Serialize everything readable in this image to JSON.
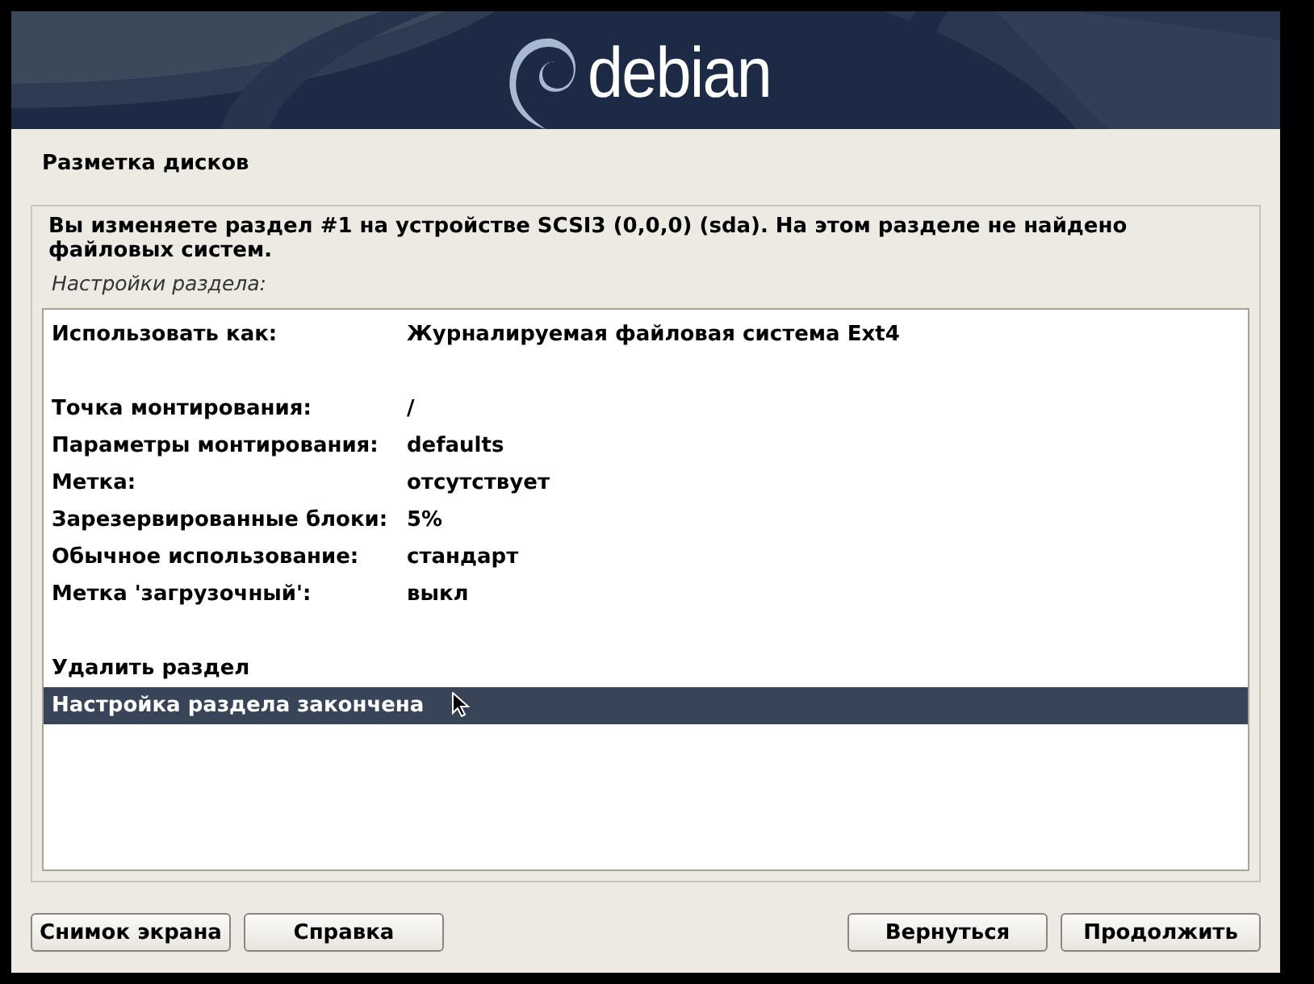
{
  "banner": {
    "logo_text": "debian"
  },
  "title": "Разметка дисков",
  "message": "Вы изменяете раздел #1 на устройстве SCSI3 (0,0,0) (sda). На этом разделе не найдено файловых систем.",
  "list_caption": "Настройки раздела:",
  "groups": [
    [
      {
        "kind": "setting",
        "label": "Использовать как:",
        "value": "Журналируемая файловая система Ext4",
        "selected": false
      }
    ],
    [
      {
        "kind": "setting",
        "label": "Точка монтирования:",
        "value": "/",
        "selected": false
      },
      {
        "kind": "setting",
        "label": "Параметры монтирования:",
        "value": "defaults",
        "selected": false
      },
      {
        "kind": "setting",
        "label": "Метка:",
        "value": "отсутствует",
        "selected": false
      },
      {
        "kind": "setting",
        "label": "Зарезервированные блоки:",
        "value": "5%",
        "selected": false
      },
      {
        "kind": "setting",
        "label": "Обычное использование:",
        "value": "стандарт",
        "selected": false
      },
      {
        "kind": "setting",
        "label": "Метка 'загрузочный':",
        "value": "выкл",
        "selected": false
      }
    ],
    [
      {
        "kind": "action",
        "label": "Удалить раздел",
        "selected": false
      },
      {
        "kind": "action",
        "label": "Настройка раздела закончена",
        "selected": true
      }
    ]
  ],
  "buttons_left": [
    "Снимок экрана",
    "Справка"
  ],
  "buttons_right": [
    "Вернуться",
    "Продолжить"
  ]
}
